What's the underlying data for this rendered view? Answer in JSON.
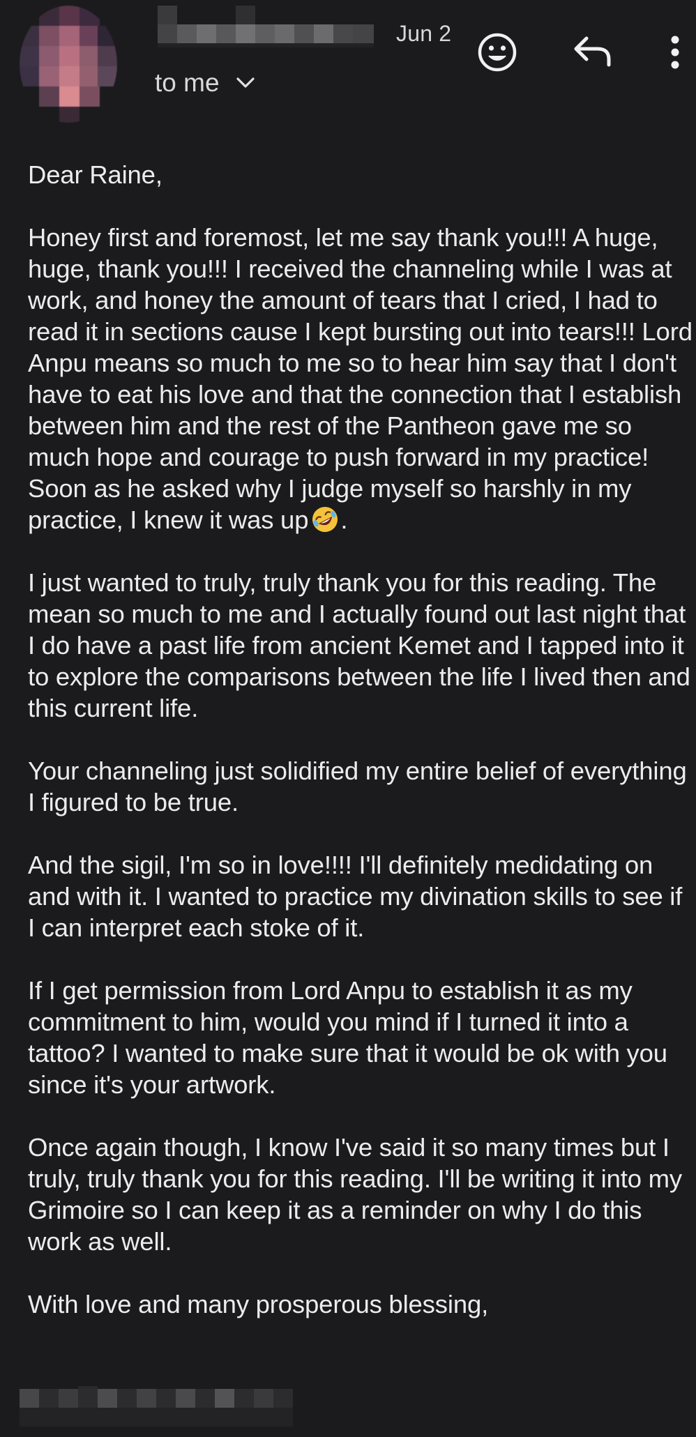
{
  "header": {
    "date": "Jun 2",
    "recipient_label": "to me"
  },
  "icons": {
    "avatar": "blurred-avatar",
    "sender": "redacted-sender-name",
    "emoji_react": "smiley-face-icon",
    "reply": "reply-arrow-icon",
    "more": "vertical-dots-icon",
    "expand": "chevron-down-icon",
    "laughing": "rolling-on-floor-laughing-emoji"
  },
  "colors": {
    "background": "#1b1b1d",
    "text": "#ececee",
    "icon": "#f1f1f3"
  },
  "email": {
    "greeting": "Dear Raine,",
    "p1": "Honey first and foremost, let me say thank you!!! A huge, huge, thank you!!! I received the channeling while I was at work, and honey the amount of tears that I cried, I had to read it in sections cause I kept bursting out into tears!!! Lord Anpu means so much to me so to hear him say that I don't have to eat his love and that the connection that I establish between him and the rest of the Pantheon gave me so much hope and courage to push forward in my practice! Soon as he asked why I judge myself so harshly in my practice, I knew it was up",
    "p1_end": ".",
    "p2": "I just wanted to truly, truly thank you for this reading. The mean so much to me and I actually found out last night that I do have a past life from ancient Kemet and I tapped into it to explore the comparisons between the life I lived then and this current life.",
    "p3": "Your channeling just solidified my entire belief of everything I figured to be true.",
    "p4": "And the sigil, I'm so in love!!!! I'll definitely medidating on and with it. I wanted to practice my divination skills to see if I can interpret each stoke of it.",
    "p5": "If I get permission from Lord Anpu to establish it as my commitment to him, would you mind if I turned it into a tattoo? I wanted to make sure that it would be ok with you since it's your artwork.",
    "p6": "Once again though, I know I've said it so many times but I truly, truly thank you for this reading. I'll be writing it into my Grimoire so I can keep it as a reminder on why I do this work as well.",
    "closing": "With love and many prosperous blessing,"
  }
}
